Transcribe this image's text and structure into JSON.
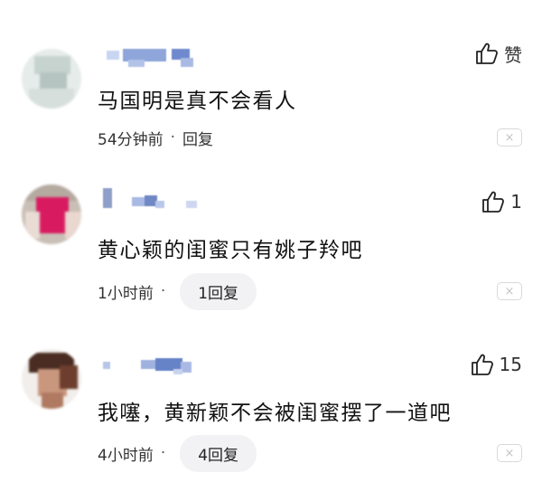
{
  "comments": [
    {
      "like_label": "赞",
      "content": "马国明是真不会看人",
      "time": "54分钟前",
      "separator": "·",
      "reply": "回复",
      "close_glyph": "×"
    },
    {
      "like_label": "1",
      "content": "黄心颖的闺蜜只有姚子羚吧",
      "time": "1小时前",
      "separator": "·",
      "reply": "1回复",
      "close_glyph": "×"
    },
    {
      "like_label": "15",
      "content": "我噻，黄新颖不会被闺蜜摆了一道吧",
      "time": "4小时前",
      "separator": "·",
      "reply": "4回复",
      "close_glyph": "×"
    }
  ]
}
